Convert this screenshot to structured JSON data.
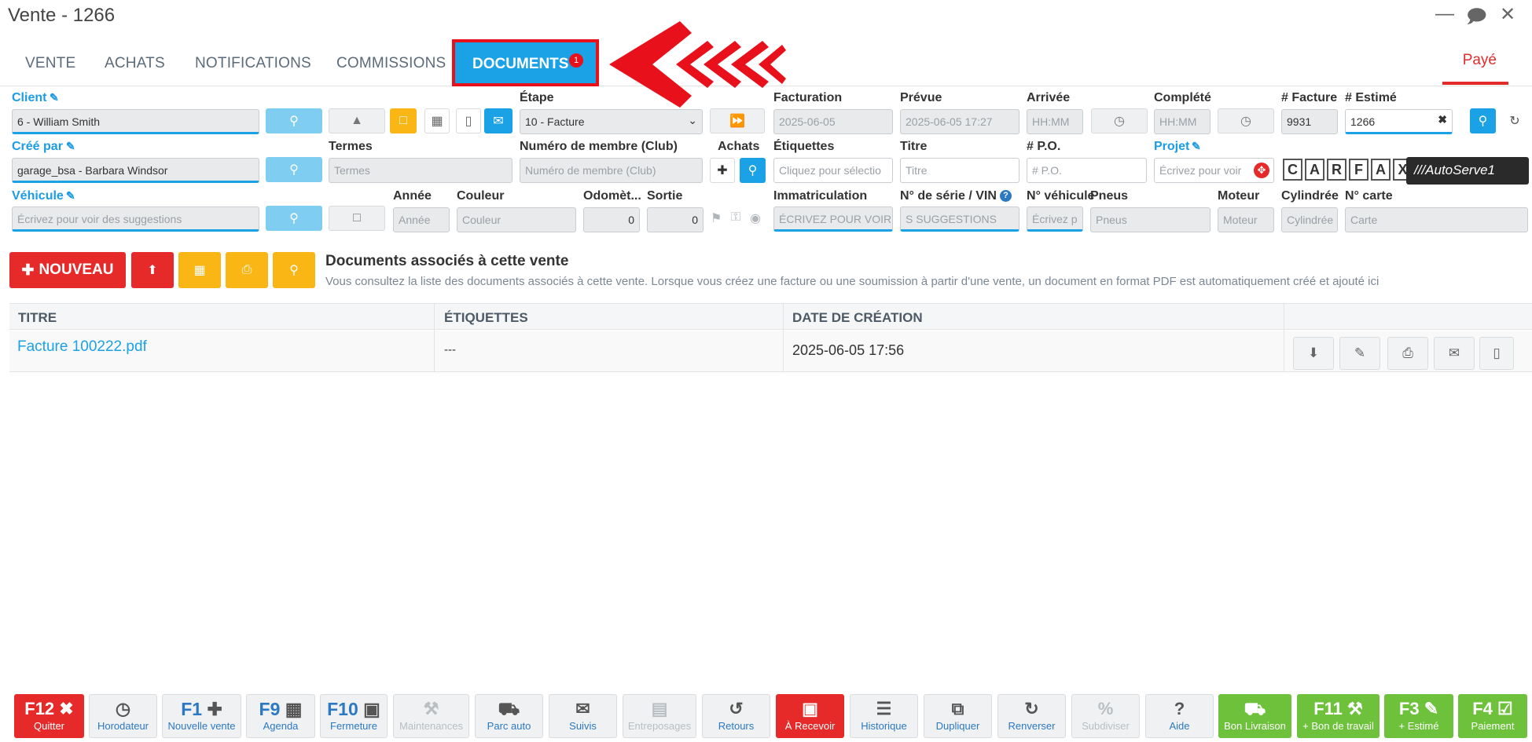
{
  "window": {
    "title": "Vente - 1266"
  },
  "tabs": [
    {
      "label": "VENTE"
    },
    {
      "label": "ACHATS"
    },
    {
      "label": "NOTIFICATIONS"
    },
    {
      "label": "COMMISSIONS"
    }
  ],
  "active_tab": {
    "label": "DOCUMENTS",
    "badge": "1"
  },
  "status": "Payé",
  "form": {
    "client": {
      "label": "Client",
      "value": "6 - William Smith"
    },
    "etape": {
      "label": "Étape",
      "value": "10 - Facture"
    },
    "facturation": {
      "label": "Facturation",
      "value": "2025-06-05"
    },
    "prevue": {
      "label": "Prévue",
      "value": "2025-06-05 17:27"
    },
    "arrivee": {
      "label": "Arrivée",
      "placeholder": "HH:MM"
    },
    "complete": {
      "label": "Complété",
      "placeholder": "HH:MM"
    },
    "facture": {
      "label": "# Facture",
      "value": "9931"
    },
    "estime": {
      "label": "# Estimé",
      "value": "1266"
    },
    "cree_par": {
      "label": "Créé par",
      "value": "garage_bsa - Barbara Windsor"
    },
    "termes": {
      "label": "Termes",
      "placeholder": "Termes"
    },
    "membre": {
      "label": "Numéro de membre (Club)",
      "placeholder": "Numéro de membre (Club)"
    },
    "achats": {
      "label": "Achats"
    },
    "etiquettes": {
      "label": "Étiquettes",
      "placeholder": "Cliquez pour sélectio"
    },
    "titre": {
      "label": "Titre",
      "placeholder": "Titre"
    },
    "po": {
      "label": "# P.O.",
      "placeholder": "# P.O."
    },
    "projet": {
      "label": "Projet",
      "placeholder": "Écrivez pour voir"
    },
    "vehicule": {
      "label": "Véhicule",
      "placeholder": "Écrivez pour voir des suggestions"
    },
    "annee": {
      "label": "Année",
      "placeholder": "Année"
    },
    "couleur": {
      "label": "Couleur",
      "placeholder": "Couleur"
    },
    "odometre": {
      "label": "Odomèt...",
      "value": "0"
    },
    "sortie": {
      "label": "Sortie",
      "value": "0"
    },
    "immatriculation": {
      "label": "Immatriculation",
      "placeholder": "ÉCRIVEZ POUR VOIR"
    },
    "vin": {
      "label": "N° de série / VIN",
      "placeholder": "S SUGGESTIONS"
    },
    "no_vehicule": {
      "label": "N° véhicule",
      "placeholder": "Écrivez p"
    },
    "pneus": {
      "label": "Pneus",
      "placeholder": "Pneus"
    },
    "moteur": {
      "label": "Moteur",
      "placeholder": "Moteur"
    },
    "cylindree": {
      "label": "Cylindrée",
      "placeholder": "Cylindrée"
    },
    "carte": {
      "label": "N° carte",
      "placeholder": "Carte"
    }
  },
  "brands": {
    "carfax": [
      "C",
      "A",
      "R",
      "F",
      "A",
      "X"
    ],
    "autoserve": "///AutoServe1"
  },
  "toolbar": {
    "new_label": "NOUVEAU"
  },
  "section": {
    "title": "Documents associés à cette vente",
    "subtitle": "Vous consultez la liste des documents associés à cette vente. Lorsque vous créez une facture ou une soumission à partir d'une vente, un document en format PDF est automatiquement créé et ajouté ici"
  },
  "table": {
    "columns": [
      "TITRE",
      "ÉTIQUETTES",
      "DATE DE CRÉATION"
    ],
    "rows": [
      {
        "titre": "Facture 100222.pdf",
        "etiquettes": "---",
        "date": "2025-06-05 17:56"
      }
    ]
  },
  "footer": [
    {
      "key": "F12",
      "label": "Quitter",
      "style": "red",
      "icon": "x-icon"
    },
    {
      "key": "",
      "label": "Horodateur",
      "style": "normal",
      "icon": "clock-icon"
    },
    {
      "key": "F1",
      "label": "Nouvelle vente",
      "style": "normal",
      "icon": "plus-icon"
    },
    {
      "key": "F9",
      "label": "Agenda",
      "style": "normal",
      "icon": "calendar-icon"
    },
    {
      "key": "F10",
      "label": "Fermeture",
      "style": "normal",
      "icon": "lock-icon"
    },
    {
      "key": "",
      "label": "Maintenances",
      "style": "disabled",
      "icon": "wrench-icon"
    },
    {
      "key": "",
      "label": "Parc auto",
      "style": "normal",
      "icon": "car-icon"
    },
    {
      "key": "",
      "label": "Suivis",
      "style": "normal",
      "icon": "envelope-icon"
    },
    {
      "key": "",
      "label": "Entreposages",
      "style": "disabled",
      "icon": "archive-icon"
    },
    {
      "key": "",
      "label": "Retours",
      "style": "normal",
      "icon": "undo-icon"
    },
    {
      "key": "",
      "label": "À Recevoir",
      "style": "red",
      "icon": "money-icon"
    },
    {
      "key": "",
      "label": "Historique",
      "style": "normal",
      "icon": "list-icon"
    },
    {
      "key": "",
      "label": "Dupliquer",
      "style": "normal",
      "icon": "copy-icon"
    },
    {
      "key": "",
      "label": "Renverser",
      "style": "normal",
      "icon": "refresh-icon"
    },
    {
      "key": "",
      "label": "Subdiviser",
      "style": "disabled",
      "icon": "percent-icon"
    },
    {
      "key": "",
      "label": "Aide",
      "style": "normal",
      "icon": "question-icon"
    },
    {
      "key": "",
      "label": "Bon Livraison",
      "style": "green",
      "icon": "truck-icon"
    },
    {
      "key": "F11",
      "label": "+ Bon de travail",
      "style": "green",
      "icon": "wrench-icon"
    },
    {
      "key": "F3",
      "label": "+ Estimé",
      "style": "green",
      "icon": "edit-icon"
    },
    {
      "key": "F4",
      "label": "Paiement",
      "style": "green",
      "icon": "check-icon"
    }
  ],
  "colors": {
    "accent": "#1aa1e6",
    "danger": "#e62a2a",
    "warning": "#f9b614",
    "success": "#6dc13b"
  }
}
